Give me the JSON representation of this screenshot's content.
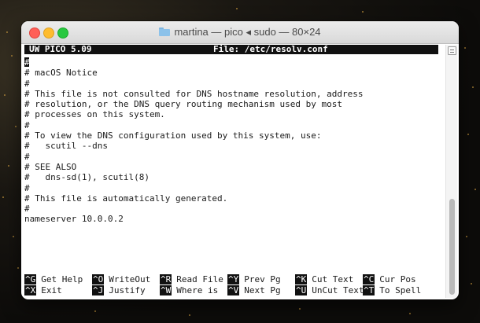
{
  "window": {
    "title": "martina — pico ◂ sudo — 80×24"
  },
  "pico": {
    "version": "UW PICO 5.09",
    "file_label": "File: /etc/resolv.conf"
  },
  "editor_lines": [
    "#",
    "# macOS Notice",
    "#",
    "# This file is not consulted for DNS hostname resolution, address",
    "# resolution, or the DNS query routing mechanism used by most",
    "# processes on this system.",
    "#",
    "# To view the DNS configuration used by this system, use:",
    "#   scutil --dns",
    "#",
    "# SEE ALSO",
    "#   dns-sd(1), scutil(8)",
    "#",
    "# This file is automatically generated.",
    "#",
    "nameserver 10.0.0.2"
  ],
  "shortcuts": {
    "row1": [
      {
        "key": "^G",
        "label": "Get Help"
      },
      {
        "key": "^O",
        "label": "WriteOut"
      },
      {
        "key": "^R",
        "label": "Read File"
      },
      {
        "key": "^Y",
        "label": "Prev Pg"
      },
      {
        "key": "^K",
        "label": "Cut Text"
      },
      {
        "key": "^C",
        "label": "Cur Pos"
      }
    ],
    "row2": [
      {
        "key": "^X",
        "label": "Exit"
      },
      {
        "key": "^J",
        "label": "Justify"
      },
      {
        "key": "^W",
        "label": "Where is"
      },
      {
        "key": "^V",
        "label": "Next Pg"
      },
      {
        "key": "^U",
        "label": "UnCut Text"
      },
      {
        "key": "^T",
        "label": "To Spell"
      }
    ]
  },
  "colors": {
    "close": "#ff5f57",
    "minimize": "#febc2e",
    "zoom": "#28c840"
  }
}
